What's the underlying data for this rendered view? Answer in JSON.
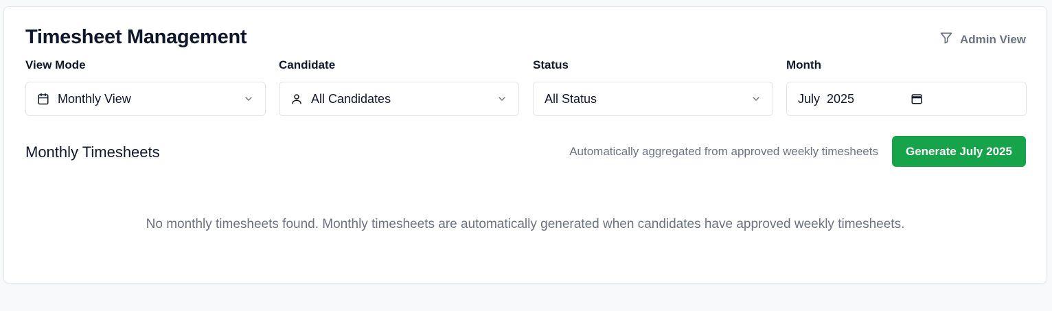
{
  "header": {
    "title": "Timesheet Management",
    "admin_view_label": "Admin View"
  },
  "filters": {
    "view_mode": {
      "label": "View Mode",
      "value": "Monthly View",
      "icon": "calendar-icon"
    },
    "candidate": {
      "label": "Candidate",
      "value": "All Candidates",
      "icon": "user-icon"
    },
    "status": {
      "label": "Status",
      "value": "All Status"
    },
    "month": {
      "label": "Month",
      "value": "July  2025",
      "icon": "calendar-icon"
    }
  },
  "section": {
    "title": "Monthly Timesheets",
    "note": "Automatically aggregated from approved weekly timesheets",
    "generate_label": "Generate July 2025"
  },
  "empty_state": "No monthly timesheets found. Monthly timesheets are automatically generated when candidates have approved weekly timesheets.",
  "colors": {
    "accent": "#16a34a",
    "muted": "#6b7280"
  }
}
